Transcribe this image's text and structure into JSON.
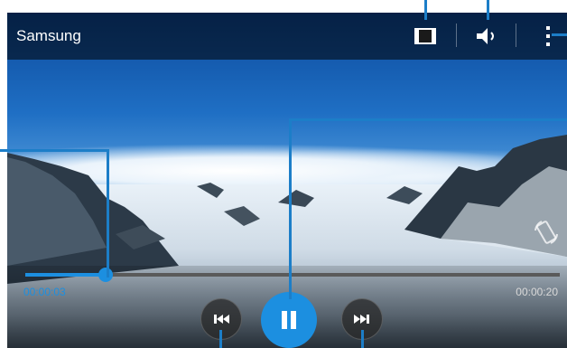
{
  "header": {
    "title": "Samsung"
  },
  "icons": {
    "pop_up_play": "pop-up-play-icon",
    "volume": "volume-icon",
    "more": "more-options-icon",
    "rotate": "screen-rotate-icon",
    "prev": "previous-icon",
    "pause": "pause-icon",
    "next": "next-icon"
  },
  "playback": {
    "elapsed": "00:00:03",
    "total": "00:00:20",
    "progress_fraction": 0.15
  },
  "colors": {
    "accent": "#1c8fe0",
    "callout": "#1c7ec8"
  }
}
